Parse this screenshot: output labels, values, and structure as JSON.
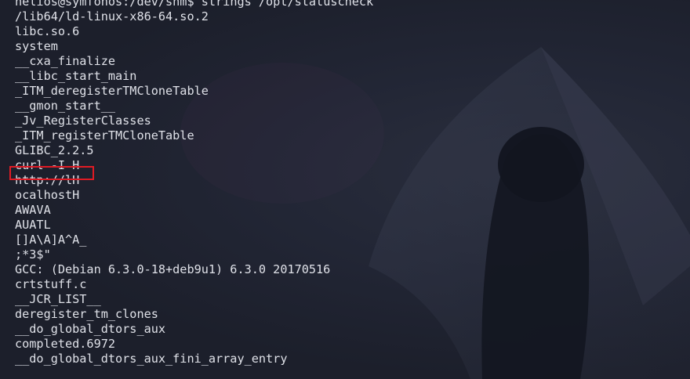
{
  "terminal": {
    "prompt": "helios@symfonos:/dev/shm$ ",
    "command": "strings /opt/statuscheck",
    "output": [
      "/lib64/ld-linux-x86-64.so.2",
      "libc.so.6",
      "system",
      "__cxa_finalize",
      "__libc_start_main",
      "_ITM_deregisterTMCloneTable",
      "__gmon_start__",
      "_Jv_RegisterClasses",
      "_ITM_registerTMCloneTable",
      "GLIBC_2.2.5",
      "curl -I H",
      "http://lH",
      "ocalhostH",
      "AWAVA",
      "AUATL",
      "[]A\\A]A^A_",
      ";*3$\"",
      "GCC: (Debian 6.3.0-18+deb9u1) 6.3.0 20170516",
      "crtstuff.c",
      "__JCR_LIST__",
      "deregister_tm_clones",
      "__do_global_dtors_aux",
      "completed.6972",
      "__do_global_dtors_aux_fini_array_entry"
    ]
  },
  "colors": {
    "background": "#1c1f2b",
    "text": "#dfe1e8",
    "highlight": "#e01b24"
  },
  "icons": {
    "wallpaper": "kali-dragon-hood-silhouette"
  }
}
